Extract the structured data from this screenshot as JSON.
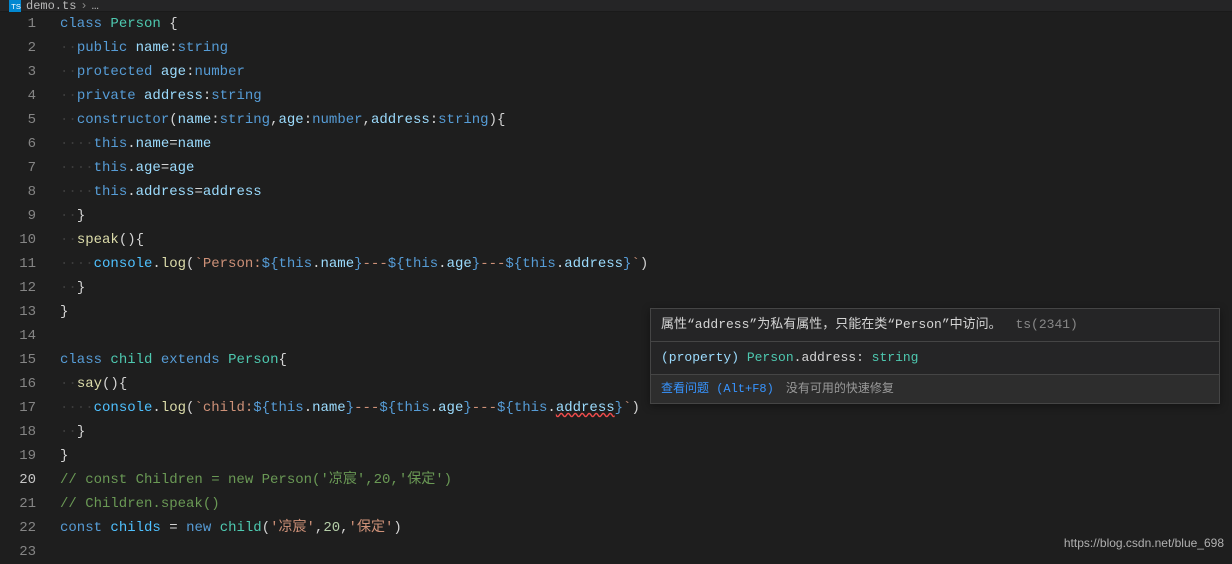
{
  "tab": {
    "file": "demo.ts",
    "breadcrumb_rest": "…"
  },
  "lines": {
    "1": [
      [
        "kw",
        "class"
      ],
      [
        "ws",
        " "
      ],
      [
        "type",
        "Person"
      ],
      [
        "ws",
        " "
      ],
      [
        "pun",
        "{"
      ]
    ],
    "2": [
      [
        "ws",
        "··"
      ],
      [
        "kw",
        "public"
      ],
      [
        "ws",
        " "
      ],
      [
        "var",
        "name"
      ],
      [
        "pun",
        ":"
      ],
      [
        "typekw",
        "string"
      ]
    ],
    "3": [
      [
        "ws",
        "··"
      ],
      [
        "kw",
        "protected"
      ],
      [
        "ws",
        " "
      ],
      [
        "var",
        "age"
      ],
      [
        "pun",
        ":"
      ],
      [
        "typekw",
        "number"
      ]
    ],
    "4": [
      [
        "ws",
        "··"
      ],
      [
        "kw",
        "private"
      ],
      [
        "ws",
        " "
      ],
      [
        "var",
        "address"
      ],
      [
        "pun",
        ":"
      ],
      [
        "typekw",
        "string"
      ]
    ],
    "5": [
      [
        "ws",
        "··"
      ],
      [
        "kw",
        "constructor"
      ],
      [
        "pun",
        "("
      ],
      [
        "var",
        "name"
      ],
      [
        "pun",
        ":"
      ],
      [
        "typekw",
        "string"
      ],
      [
        "pun",
        ","
      ],
      [
        "var",
        "age"
      ],
      [
        "pun",
        ":"
      ],
      [
        "typekw",
        "number"
      ],
      [
        "pun",
        ","
      ],
      [
        "var",
        "address"
      ],
      [
        "pun",
        ":"
      ],
      [
        "typekw",
        "string"
      ],
      [
        "pun",
        ")"
      ],
      [
        "pun",
        "{"
      ]
    ],
    "6": [
      [
        "ws",
        "····"
      ],
      [
        "kw",
        "this"
      ],
      [
        "pun",
        "."
      ],
      [
        "var",
        "name"
      ],
      [
        "op",
        "="
      ],
      [
        "var",
        "name"
      ]
    ],
    "7": [
      [
        "ws",
        "····"
      ],
      [
        "kw",
        "this"
      ],
      [
        "pun",
        "."
      ],
      [
        "var",
        "age"
      ],
      [
        "op",
        "="
      ],
      [
        "var",
        "age"
      ]
    ],
    "8": [
      [
        "ws",
        "····"
      ],
      [
        "kw",
        "this"
      ],
      [
        "pun",
        "."
      ],
      [
        "var",
        "address"
      ],
      [
        "op",
        "="
      ],
      [
        "var",
        "address"
      ]
    ],
    "9": [
      [
        "ws",
        "··"
      ],
      [
        "pun",
        "}"
      ]
    ],
    "10": [
      [
        "ws",
        "··"
      ],
      [
        "fn",
        "speak"
      ],
      [
        "pun",
        "()"
      ],
      [
        "pun",
        "{"
      ]
    ],
    "11": [
      [
        "ws",
        "····"
      ],
      [
        "obj",
        "console"
      ],
      [
        "pun",
        "."
      ],
      [
        "fn",
        "log"
      ],
      [
        "pun",
        "("
      ],
      [
        "str",
        "`Person:"
      ],
      [
        "tplp",
        "${"
      ],
      [
        "kw",
        "this"
      ],
      [
        "pun",
        "."
      ],
      [
        "var",
        "name"
      ],
      [
        "tplp",
        "}"
      ],
      [
        "str",
        "---"
      ],
      [
        "tplp",
        "${"
      ],
      [
        "kw",
        "this"
      ],
      [
        "pun",
        "."
      ],
      [
        "var",
        "age"
      ],
      [
        "tplp",
        "}"
      ],
      [
        "str",
        "---"
      ],
      [
        "tplp",
        "${"
      ],
      [
        "kw",
        "this"
      ],
      [
        "pun",
        "."
      ],
      [
        "var",
        "address"
      ],
      [
        "tplp",
        "}"
      ],
      [
        "str",
        "`"
      ],
      [
        "pun",
        ")"
      ]
    ],
    "12": [
      [
        "ws",
        "··"
      ],
      [
        "pun",
        "}"
      ]
    ],
    "13": [
      [
        "pun",
        "}"
      ]
    ],
    "14": [
      [
        "pun",
        ""
      ]
    ],
    "15": [
      [
        "kw",
        "class"
      ],
      [
        "ws",
        " "
      ],
      [
        "type",
        "child"
      ],
      [
        "ws",
        " "
      ],
      [
        "kw",
        "extends"
      ],
      [
        "ws",
        " "
      ],
      [
        "type",
        "Person"
      ],
      [
        "pun",
        "{"
      ]
    ],
    "16": [
      [
        "ws",
        "··"
      ],
      [
        "fn",
        "say"
      ],
      [
        "pun",
        "()"
      ],
      [
        "pun",
        "{"
      ]
    ],
    "17": [
      [
        "ws",
        "····"
      ],
      [
        "obj",
        "console"
      ],
      [
        "pun",
        "."
      ],
      [
        "fn",
        "log"
      ],
      [
        "pun",
        "("
      ],
      [
        "str",
        "`child:"
      ],
      [
        "tplp",
        "${"
      ],
      [
        "kw",
        "this"
      ],
      [
        "pun",
        "."
      ],
      [
        "var",
        "name"
      ],
      [
        "tplp",
        "}"
      ],
      [
        "str",
        "---"
      ],
      [
        "tplp",
        "${"
      ],
      [
        "kw",
        "this"
      ],
      [
        "pun",
        "."
      ],
      [
        "var",
        "age"
      ],
      [
        "tplp",
        "}"
      ],
      [
        "str",
        "---"
      ],
      [
        "tplp",
        "${"
      ],
      [
        "kw",
        "this"
      ],
      [
        "pun",
        "."
      ],
      [
        "var err",
        "address"
      ],
      [
        "tplp",
        "}"
      ],
      [
        "str",
        "`"
      ],
      [
        "pun",
        ")"
      ]
    ],
    "18": [
      [
        "ws",
        "··"
      ],
      [
        "pun",
        "}"
      ]
    ],
    "19": [
      [
        "pun",
        "}"
      ]
    ],
    "20": [
      [
        "cmt",
        "// const Children = new Person('凉宸',20,'保定')"
      ]
    ],
    "21": [
      [
        "cmt",
        "// Children.speak()"
      ]
    ],
    "22": [
      [
        "kw",
        "const"
      ],
      [
        "ws",
        " "
      ],
      [
        "obj",
        "childs"
      ],
      [
        "ws",
        " "
      ],
      [
        "op",
        "="
      ],
      [
        "ws",
        " "
      ],
      [
        "kw",
        "new"
      ],
      [
        "ws",
        " "
      ],
      [
        "type",
        "child"
      ],
      [
        "pun",
        "("
      ],
      [
        "str",
        "'凉宸'"
      ],
      [
        "pun",
        ","
      ],
      [
        "num",
        "20"
      ],
      [
        "pun",
        ","
      ],
      [
        "str",
        "'保定'"
      ],
      [
        "pun",
        ")"
      ]
    ],
    "23": [
      [
        "pun",
        ""
      ]
    ]
  },
  "activeLine": 20,
  "hover": {
    "message": "属性“address”为私有属性，只能在类“Person”中访问。",
    "code": "ts(2341)",
    "signature": {
      "pre": "(property) ",
      "cls": "Person",
      "dot": ".",
      "prop": "address",
      "colon": ": ",
      "type": "string"
    },
    "actions": {
      "view_problem": "查看问题 (Alt+F8)",
      "no_fix": "没有可用的快速修复"
    }
  },
  "watermark": "https://blog.csdn.net/blue_698"
}
